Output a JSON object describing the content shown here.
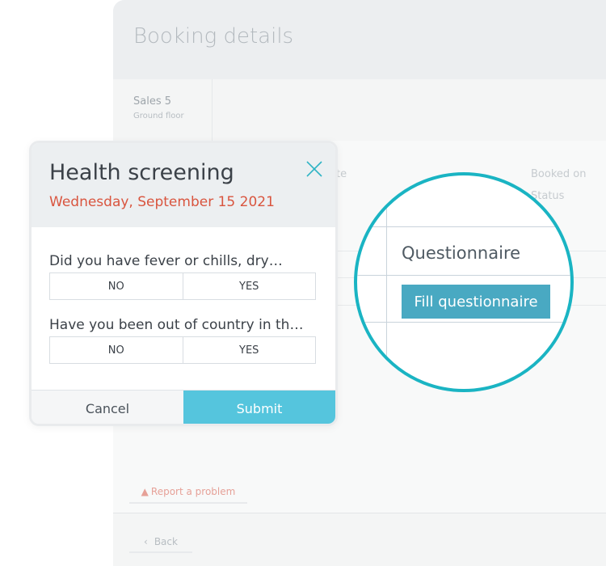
{
  "background": {
    "title": "Booking details",
    "room": {
      "name": "Sales 5",
      "floor": "Ground floor"
    },
    "columns": {
      "date_partial": "te",
      "booked_on": "Booked on",
      "status": "Status"
    },
    "report_label": "Report a problem",
    "back_label": "Back"
  },
  "zoom": {
    "column_header": "Questionnaire",
    "fill_button": "Fill questionnaire"
  },
  "modal": {
    "title": "Health screening",
    "date": "Wednesday, September 15 2021",
    "questions": [
      {
        "text": "Did you have fever or chills, dry…",
        "no": "NO",
        "yes": "YES"
      },
      {
        "text": "Have you been out of country in th…",
        "no": "NO",
        "yes": "YES"
      }
    ],
    "cancel_label": "Cancel",
    "submit_label": "Submit"
  },
  "colors": {
    "accent": "#1ab4c3",
    "submit": "#55c5dd",
    "date": "#d9553f",
    "fill_button": "#49a9c2"
  }
}
